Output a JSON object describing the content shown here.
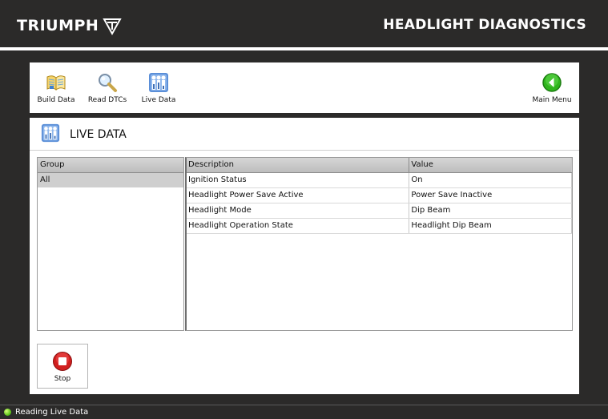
{
  "header": {
    "brand": "TRIUMPH",
    "title": "HEADLIGHT DIAGNOSTICS"
  },
  "toolbar": {
    "items": [
      {
        "label": "Build Data",
        "icon": "book-icon"
      },
      {
        "label": "Read DTCs",
        "icon": "magnifier-icon"
      },
      {
        "label": "Live Data",
        "icon": "live-data-icon"
      }
    ],
    "main_menu": {
      "label": "Main Menu",
      "icon": "back-arrow-icon"
    }
  },
  "section": {
    "title": "LIVE DATA",
    "icon": "live-data-icon"
  },
  "groups": {
    "header": "Group",
    "items": [
      "All"
    ],
    "selected": "All"
  },
  "table": {
    "columns": [
      "Description",
      "Value"
    ],
    "rows": [
      {
        "description": "Ignition Status",
        "value": "On"
      },
      {
        "description": "Headlight Power Save Active",
        "value": "Power Save Inactive"
      },
      {
        "description": "Headlight Mode",
        "value": "Dip Beam"
      },
      {
        "description": "Headlight Operation State",
        "value": "Headlight Dip Beam"
      }
    ]
  },
  "stop": {
    "label": "Stop",
    "icon": "stop-icon"
  },
  "status": {
    "text": "Reading Live Data",
    "indicator_color": "#5fc51a"
  },
  "colors": {
    "chrome": "#2b2a29",
    "panel": "#ffffff",
    "header_row": "#c8c8c8",
    "selected_row": "#cfcfcf",
    "accent_green": "#2fb51c",
    "stop_red": "#d11f1f"
  }
}
